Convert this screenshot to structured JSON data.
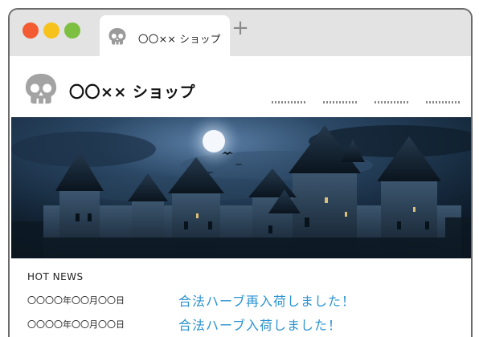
{
  "browser": {
    "tab_title": "〇〇×× ショップ",
    "new_tab_symbol": "+",
    "traffic_lights": {
      "close": "#f35c33",
      "minimize": "#f7c21b",
      "maximize": "#7dc041"
    }
  },
  "site": {
    "name": "〇〇×× ショップ",
    "logo_icon": "skull-icon",
    "nav_placeholder_count": 4
  },
  "hero": {
    "image": "haunted-castle-night-moon"
  },
  "news": {
    "heading": "HOT NEWS",
    "items": [
      {
        "date": "〇〇〇〇年〇〇月〇〇日",
        "title": "合法ハーブ再入荷しました！"
      },
      {
        "date": "〇〇〇〇年〇〇月〇〇日",
        "title": "合法ハーブ入荷しました！"
      }
    ]
  },
  "colors": {
    "link": "#2b93d1",
    "titlebar": "#e3e3e3",
    "window_border": "#6b6b6b"
  }
}
